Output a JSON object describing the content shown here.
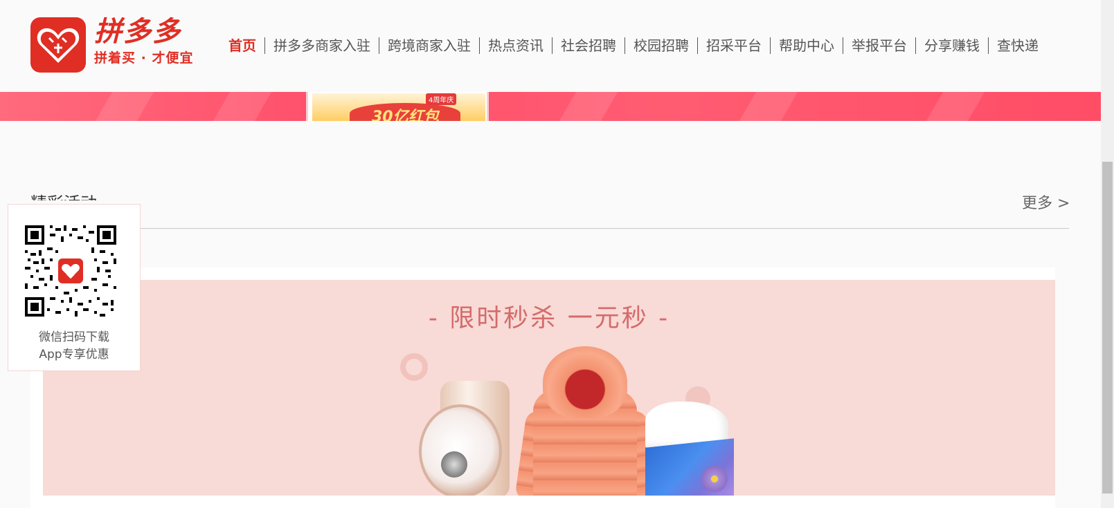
{
  "header": {
    "logo_title": "拼多多",
    "logo_slogan": "拼着买 · 才便宜",
    "logo_icon": "pinduoduo-heart-logo",
    "brand_color": "#e02e24"
  },
  "nav": {
    "items": [
      {
        "label": "首页",
        "active": true
      },
      {
        "label": "拼多多商家入驻",
        "active": false
      },
      {
        "label": "跨境商家入驻",
        "active": false
      },
      {
        "label": "热点资讯",
        "active": false
      },
      {
        "label": "社会招聘",
        "active": false
      },
      {
        "label": "校园招聘",
        "active": false
      },
      {
        "label": "招采平台",
        "active": false
      },
      {
        "label": "帮助中心",
        "active": false
      },
      {
        "label": "举报平台",
        "active": false
      },
      {
        "label": "分享赚钱",
        "active": false
      },
      {
        "label": "查快递",
        "active": false
      }
    ]
  },
  "strip_banner": {
    "badge": "4周年庆",
    "text": "30亿红包"
  },
  "section": {
    "title": "精彩活动",
    "more_label": "更多 >"
  },
  "promo": {
    "title": "- 限时秒杀  一元秒 -",
    "background_color": "#f8dad6",
    "title_color": "#d46b6b"
  },
  "qr_widget": {
    "caption_line1": "微信扫码下载",
    "caption_line2": "App专享优惠",
    "icon": "qr-code-icon"
  }
}
